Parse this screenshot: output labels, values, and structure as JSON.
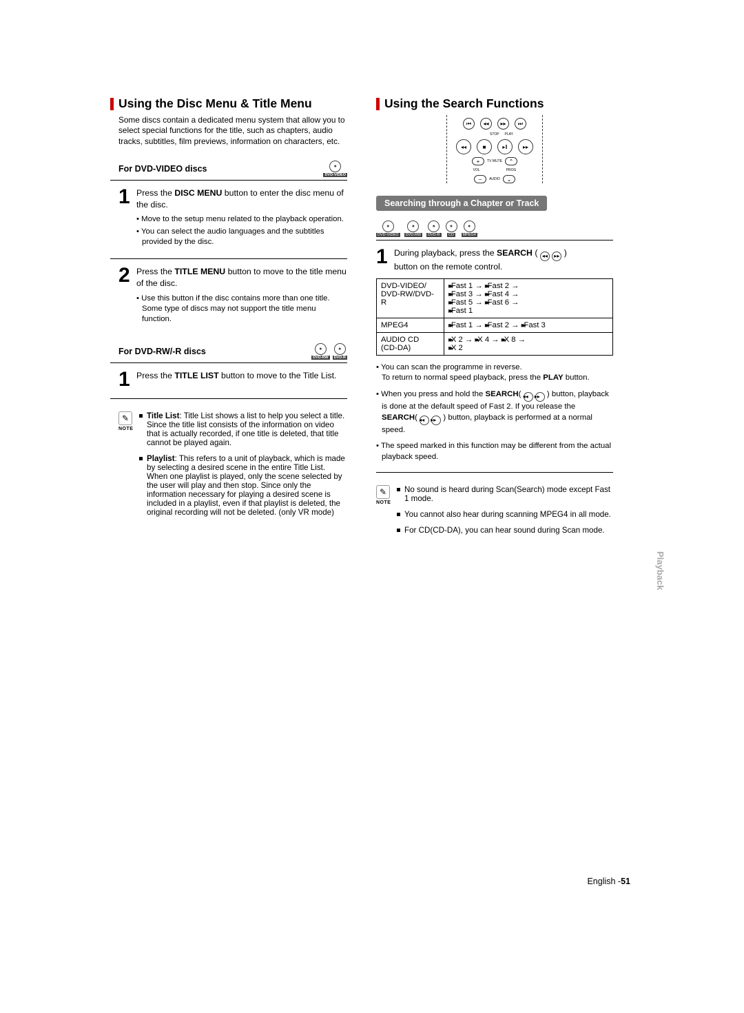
{
  "left": {
    "heading": "Using the Disc Menu & Title Menu",
    "intro": "Some discs contain a dedicated menu system that allow you to select special functions for the title, such as chapters, audio tracks, subtitles, film previews, information on characters, etc.",
    "sub1": "For DVD-VIDEO discs",
    "badge1": "DVD-VIDEO",
    "step1_b1": "DISC MENU",
    "step1_a": "Press the ",
    "step1_c": " button to enter the disc menu of the disc.",
    "step1_bul1": "Move to the setup menu related to the playback operation.",
    "step1_bul2": "You can select the audio languages and the subtitles provided by the disc.",
    "step2_a": "Press the ",
    "step2_b1": "TITLE MENU",
    "step2_c": " button to move to the title menu of the disc.",
    "step2_bul1": "Use this button if the disc contains more than one title. Some type of discs may not support the title menu function.",
    "sub2": "For DVD-RW/-R discs",
    "badge2a": "DVD-RW",
    "badge2b": "DVD-R",
    "step3_a": "Press the ",
    "step3_b1": "TITLE LIST",
    "step3_c": " button to move to the Title List.",
    "note1_h": "Title List",
    "note1_t": ": Title List shows a list to help you select a title. Since the title list consists of the information on video that is actually recorded, if one title is deleted, that title cannot be played again.",
    "note2_h": "Playlist",
    "note2_t": ": This refers to a unit of playback, which is made by selecting a desired scene in the entire Title List. When one playlist is played, only the scene selected by the user will play and then stop. Since only the information necessary for playing a desired scene is included in a playlist, even if that playlist is deleted, the original recording will not be deleted. (only VR mode)"
  },
  "right": {
    "heading": "Using the Search Functions",
    "remote_labels": {
      "stop": "STOP",
      "play": "PLAY",
      "tvmute": "TV MUTE",
      "vol": "VOL",
      "audio": "AUDIO",
      "prog": "PROG"
    },
    "pill": "Searching through a Chapter or Track",
    "badge_row": [
      "DVD-VIDEO",
      "DVD-RW",
      "DVD-R",
      "CD",
      "MPEG4"
    ],
    "step1_a": "During playback, press the ",
    "step1_b": "SEARCH",
    "step1_c": " button on the remote control.",
    "step1_d": " ( ",
    "step1_e": " )",
    "table": {
      "r1c1": "DVD-VIDEO/\nDVD-RW/DVD-R",
      "r1c2": [
        "Fast 1",
        "Fast 2",
        "Fast 3",
        "Fast 4",
        "Fast 5",
        "Fast 6",
        "Fast 1"
      ],
      "r2c1": "MPEG4",
      "r2c2": [
        "Fast 1",
        "Fast 2",
        "Fast 3"
      ],
      "r3c1": "AUDIO CD\n(CD-DA)",
      "r3c2": [
        "X 2",
        "X 4",
        "X 8",
        "X 2"
      ]
    },
    "bul1_a": "You can scan the programme in reverse.",
    "bul1_b": "To return to normal speed playback, press the ",
    "bul1_c": "PLAY",
    "bul1_d": " button.",
    "bul2_a": "When you press and hold the ",
    "bul2_b": "SEARCH",
    "bul2_c": "button, playback is done at the default speed of Fast 2. If you release the ",
    "bul2_d": "SEARCH",
    "bul2_e": " button, playback is performed at a normal speed.",
    "bul3": "The speed marked in this function may be different from the actual playback speed.",
    "note1": "No sound is heard during Scan(Search) mode except Fast 1 mode.",
    "note2": "You cannot also hear during scanning MPEG4 in all mode.",
    "note3": "For CD(CD-DA), you can hear sound during Scan mode."
  },
  "footer_a": "English -",
  "footer_b": "51",
  "sidetab": "Playback",
  "note_label": "NOTE"
}
